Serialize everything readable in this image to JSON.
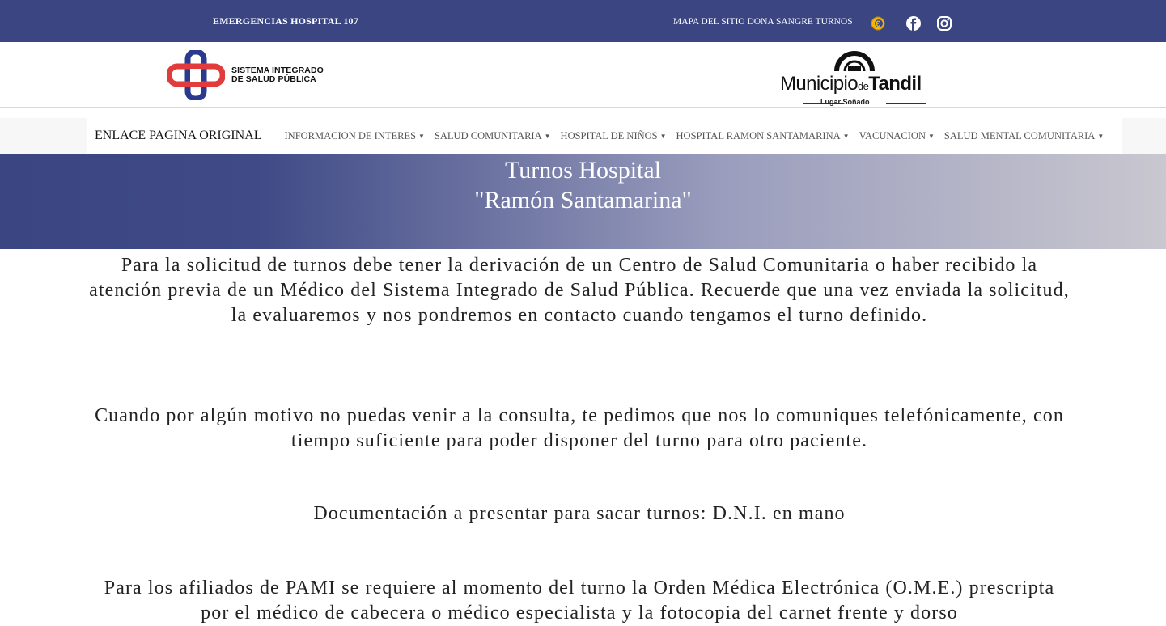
{
  "topbar": {
    "emergencias": "EMERGENCIAS HOSPITAL 107",
    "links": "MAPA DEL SITIO DONA SANGRE TURNOS",
    "icons": [
      "coin-icon",
      "facebook-icon",
      "instagram-icon"
    ],
    "bg_color": "#3a4582"
  },
  "logos": {
    "sisp_line1": "SISTEMA INTEGRADO",
    "sisp_line2": "DE SALUD PÚBLICA",
    "municipio": "Municipio",
    "de": "de",
    "tandil": "Tandil",
    "lugar": "Lugar Soñado"
  },
  "nav": {
    "brand": "ENLACE PAGINA ORIGINAL",
    "items": [
      "INFORMACION DE INTERES",
      "SALUD COMUNITARIA",
      "HOSPITAL DE NIÑOS",
      "HOSPITAL RAMON SANTAMARINA",
      "VACUNACION",
      "SALUD MENTAL COMUNITARIA"
    ]
  },
  "hero": {
    "line1": "Turnos Hospital",
    "line2": "\"Ramón Santamarina\""
  },
  "content": {
    "p1": "Para la solicitud de turnos debe tener la derivación de un Centro de Salud Comunitaria o haber recibido la atención previa de un Médico del Sistema Integrado de Salud Pública. Recuerde que una vez enviada la solicitud, la evaluaremos y nos pondremos en contacto cuando tengamos el turno definido.",
    "p2": "Cuando por algún motivo no puedas venir a la consulta, te pedimos que nos lo comuniques telefónicamente, con tiempo suficiente para poder disponer del turno para otro paciente.",
    "p3": "Documentación a presentar para sacar turnos: D.N.I. en mano",
    "p4": "Para los afiliados de PAMI se requiere al momento del turno la Orden Médica Electrónica (O.M.E.) prescripta por el médico de cabecera o médico especialista y la fotocopia del carnet frente y dorso"
  }
}
